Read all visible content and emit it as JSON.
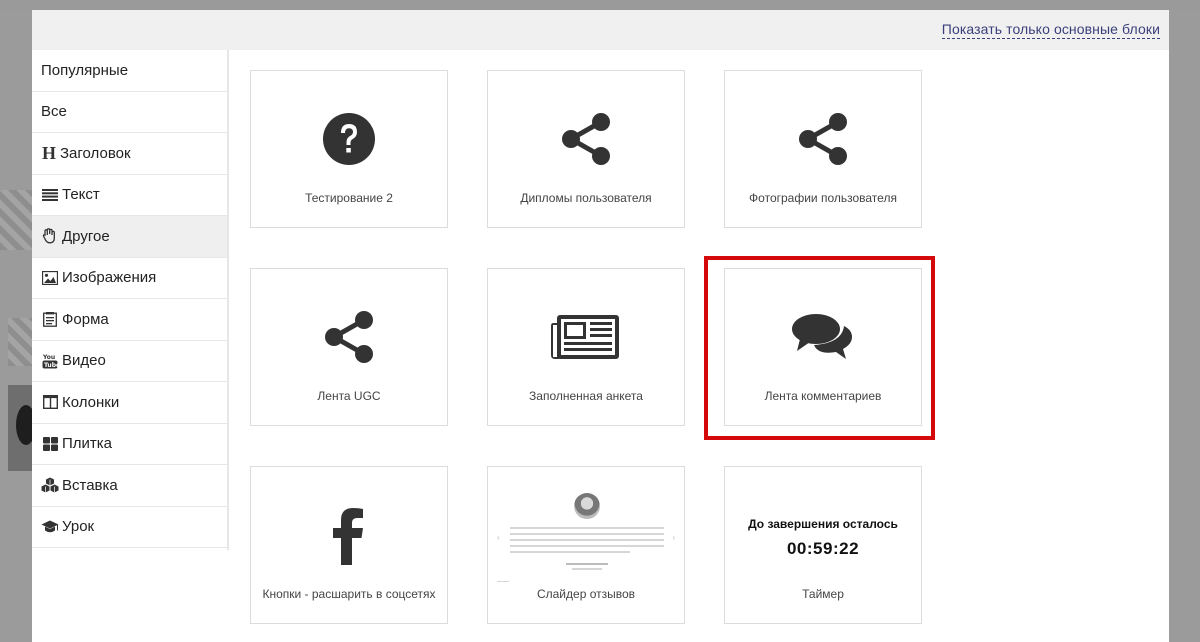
{
  "header": {
    "show_basic_label": "Показать только основные блоки"
  },
  "sidebar": {
    "items": [
      {
        "label": "Популярные",
        "icon": "none",
        "active": false
      },
      {
        "label": "Все",
        "icon": "none",
        "active": false
      },
      {
        "label": "Заголовок",
        "icon": "heading-icon",
        "active": false
      },
      {
        "label": "Текст",
        "icon": "text-lines-icon",
        "active": false
      },
      {
        "label": "Другое",
        "icon": "hand-icon",
        "active": true
      },
      {
        "label": "Изображения",
        "icon": "image-icon",
        "active": false
      },
      {
        "label": "Форма",
        "icon": "form-icon",
        "active": false
      },
      {
        "label": "Видео",
        "icon": "youtube-icon",
        "active": false
      },
      {
        "label": "Колонки",
        "icon": "columns-icon",
        "active": false
      },
      {
        "label": "Плитка",
        "icon": "tiles-icon",
        "active": false
      },
      {
        "label": "Вставка",
        "icon": "cubes-icon",
        "active": false
      },
      {
        "label": "Урок",
        "icon": "graduation-cap-icon",
        "active": false
      }
    ]
  },
  "tiles": [
    {
      "label": "Тестирование 2",
      "icon": "question-circle-icon"
    },
    {
      "label": "Дипломы пользователя",
      "icon": "share-icon"
    },
    {
      "label": "Фотографии пользователя",
      "icon": "share-icon"
    },
    {
      "label": "Лента UGC",
      "icon": "share-icon"
    },
    {
      "label": "Заполненная анкета",
      "icon": "newspaper-icon"
    },
    {
      "label": "Лента комментариев",
      "icon": "comments-icon",
      "highlighted": true
    },
    {
      "label": "Кнопки - расшарить в соцсетях",
      "icon": "facebook-icon"
    },
    {
      "label": "Слайдер отзывов",
      "icon": "review-slider-preview"
    },
    {
      "label": "Таймер",
      "icon": "timer-preview"
    }
  ],
  "timer": {
    "title": "До завершения осталось",
    "value": "00:59:22"
  },
  "colors": {
    "highlight": "#d40a0a",
    "link": "#3a3f7a",
    "icon": "#333333"
  }
}
